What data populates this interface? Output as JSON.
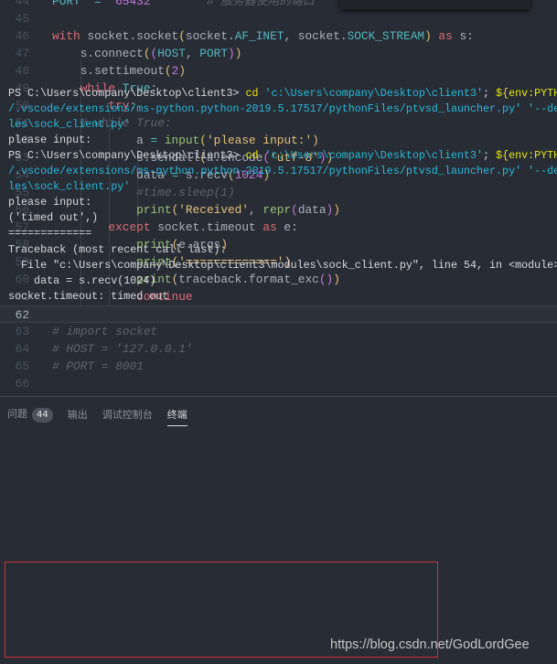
{
  "editor": {
    "current_line": 62,
    "lines": [
      {
        "num": 44,
        "tokens": [
          [
            "const",
            "PORT"
          ],
          [
            "",
            "  "
          ],
          [
            "op",
            "="
          ],
          [
            "",
            "  "
          ],
          [
            "num",
            "65432"
          ],
          [
            "",
            "        "
          ],
          [
            "cm",
            "# 服务器使用的端口"
          ]
        ]
      },
      {
        "num": 45,
        "tokens": []
      },
      {
        "num": 46,
        "tokens": [
          [
            "kw",
            "with"
          ],
          [
            "",
            " socket.socket"
          ],
          [
            "br",
            "("
          ],
          [
            "",
            "socket."
          ],
          [
            "const",
            "AF_INET"
          ],
          [
            "",
            ", socket."
          ],
          [
            "const",
            "SOCK_STREAM"
          ],
          [
            "br",
            ")"
          ],
          [
            "",
            ""
          ],
          [
            "kw",
            " as"
          ],
          [
            "",
            " s:"
          ]
        ]
      },
      {
        "num": 47,
        "tokens": [
          [
            "",
            "    s.connect"
          ],
          [
            "br",
            "("
          ],
          [
            "br2",
            "("
          ],
          [
            "const",
            "HOST"
          ],
          [
            "",
            ", "
          ],
          [
            "const",
            "PORT"
          ],
          [
            "br2",
            ")"
          ],
          [
            "br",
            ")"
          ]
        ]
      },
      {
        "num": 48,
        "tokens": [
          [
            "",
            "    s.settimeout"
          ],
          [
            "br",
            "("
          ],
          [
            "num",
            "2"
          ],
          [
            "br",
            ")"
          ]
        ]
      },
      {
        "num": 49,
        "tokens": [
          [
            "kw",
            "    while"
          ],
          [
            "const",
            " True"
          ],
          [
            "",
            ":"
          ]
        ]
      },
      {
        "num": 50,
        "tokens": [
          [
            "kw",
            "        try"
          ],
          [
            "",
            ":"
          ]
        ]
      },
      {
        "num": 51,
        "tokens": [
          [
            "cm",
            "    # while True:"
          ]
        ]
      },
      {
        "num": 52,
        "tokens": [
          [
            "",
            "            a "
          ],
          [
            "op",
            "="
          ],
          [
            "fn",
            " input"
          ],
          [
            "br",
            "("
          ],
          [
            "str",
            "'please input:'"
          ],
          [
            "br",
            ")"
          ]
        ]
      },
      {
        "num": 53,
        "tokens": [
          [
            "",
            "            s.sendall"
          ],
          [
            "br",
            "("
          ],
          [
            "",
            "a.encode"
          ],
          [
            "br2",
            "("
          ],
          [
            "str",
            "'utf-8'"
          ],
          [
            "br2",
            ")"
          ],
          [
            "br",
            ")"
          ]
        ]
      },
      {
        "num": 54,
        "tokens": [
          [
            "",
            "            data "
          ],
          [
            "op",
            "="
          ],
          [
            "",
            " s.recv"
          ],
          [
            "br",
            "("
          ],
          [
            "num",
            "1024"
          ],
          [
            "br",
            ")"
          ]
        ]
      },
      {
        "num": 55,
        "tokens": [
          [
            "cm",
            "            #time.sleep(1)"
          ]
        ]
      },
      {
        "num": 56,
        "tokens": [
          [
            "fn",
            "            print"
          ],
          [
            "br",
            "("
          ],
          [
            "str",
            "'Received'"
          ],
          [
            "",
            ", "
          ],
          [
            "fn",
            "repr"
          ],
          [
            "br2",
            "("
          ],
          [
            "",
            "data"
          ],
          [
            "br2",
            ")"
          ],
          [
            "br",
            ")"
          ]
        ]
      },
      {
        "num": 57,
        "tokens": [
          [
            "kw",
            "        except"
          ],
          [
            "",
            " socket.timeout "
          ],
          [
            "kw",
            "as"
          ],
          [
            "",
            " e:"
          ]
        ]
      },
      {
        "num": 58,
        "tokens": [
          [
            "fn",
            "            print"
          ],
          [
            "br",
            "("
          ],
          [
            "",
            "e.args"
          ],
          [
            "br",
            ")"
          ]
        ]
      },
      {
        "num": 59,
        "tokens": [
          [
            "fn",
            "            print"
          ],
          [
            "br",
            "("
          ],
          [
            "str",
            "'============='"
          ],
          [
            "br",
            ")"
          ]
        ]
      },
      {
        "num": 60,
        "tokens": [
          [
            "fn",
            "            print"
          ],
          [
            "br",
            "("
          ],
          [
            "",
            "traceback.format_exc"
          ],
          [
            "br2",
            "("
          ],
          [
            "br2",
            ")"
          ],
          [
            "br",
            ")"
          ]
        ]
      },
      {
        "num": 61,
        "tokens": [
          [
            "kw",
            "            continue"
          ]
        ]
      },
      {
        "num": 62,
        "tokens": []
      },
      {
        "num": 63,
        "tokens": [
          [
            "cm",
            "# import socket"
          ]
        ]
      },
      {
        "num": 64,
        "tokens": [
          [
            "cm",
            "# HOST = '127.0.0.1'"
          ]
        ]
      },
      {
        "num": 65,
        "tokens": [
          [
            "cm",
            "# PORT = 8001"
          ]
        ]
      },
      {
        "num": 66,
        "tokens": []
      }
    ]
  },
  "panel": {
    "tabs": [
      {
        "label": "问题",
        "badge": "44",
        "active": false
      },
      {
        "label": "输出",
        "active": false
      },
      {
        "label": "调试控制台",
        "active": false
      },
      {
        "label": "终端",
        "active": true
      }
    ],
    "terminal_lines": [
      [
        [
          "",
          "PS C:\\Users\\company\\Desktop\\client3> "
        ],
        [
          "tcmd",
          "cd"
        ],
        [
          "tstr",
          " 'c:\\Users\\company\\Desktop\\client3'"
        ],
        [
          "",
          "; "
        ],
        [
          "tcmd",
          "${env:PYTH"
        ]
      ],
      [
        [
          "tstr",
          "/.vscode/extensions/ms-python.python-2019.5.17517/pythonFiles/ptvsd_launcher.py' '--de"
        ]
      ],
      [
        [
          "tstr",
          "les\\sock_client.py'"
        ]
      ],
      [
        [
          "",
          "please input:"
        ]
      ],
      [
        [
          "",
          "PS C:\\Users\\company\\Desktop\\client3> "
        ],
        [
          "tcmd",
          "cd"
        ],
        [
          "tstr",
          " 'c:\\Users\\company\\Desktop\\client3'"
        ],
        [
          "",
          "; "
        ],
        [
          "tcmd",
          "${env:PYTH"
        ]
      ],
      [
        [
          "tstr",
          "/.vscode/extensions/ms-python.python-2019.5.17517/pythonFiles/ptvsd_launcher.py' '--de"
        ]
      ],
      [
        [
          "tstr",
          "les\\sock_client.py'"
        ]
      ],
      [
        [
          "",
          "please input:"
        ]
      ],
      [
        [
          "",
          "('timed out',)"
        ]
      ],
      [
        [
          "",
          "============="
        ]
      ],
      [
        [
          "",
          "Traceback (most recent call last):"
        ]
      ],
      [
        [
          "",
          "  File \"c:\\Users\\company\\Desktop\\client3\\modules\\sock_client.py\", line 54, in <module>"
        ]
      ],
      [
        [
          "",
          "    data = s.recv(1024)"
        ]
      ],
      [
        [
          "",
          "socket.timeout: timed out"
        ]
      ]
    ]
  },
  "watermark": "https://blog.csdn.net/GodLordGee",
  "colors": {
    "background": "#282c34",
    "highlight_box": "#d0303c"
  }
}
